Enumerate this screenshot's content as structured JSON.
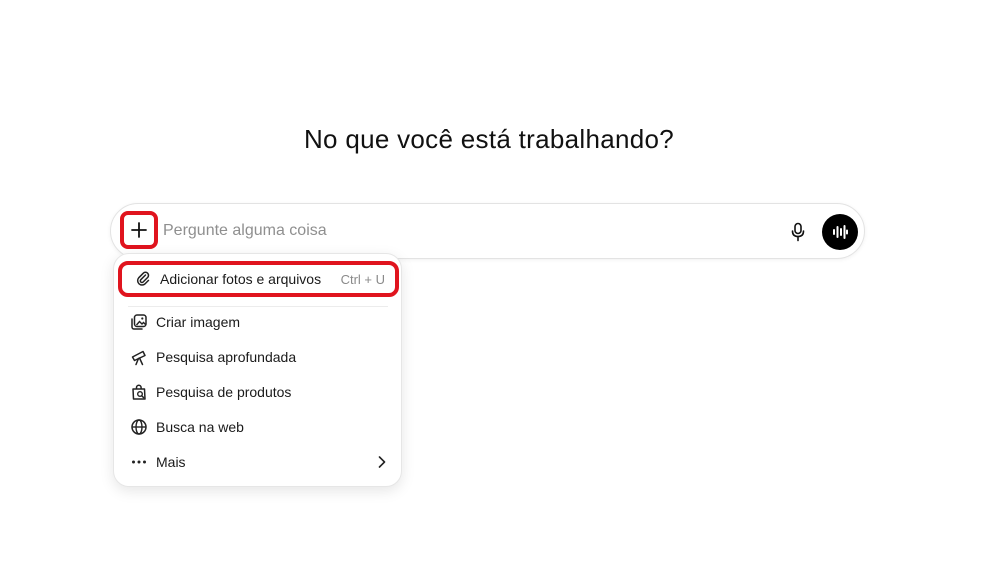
{
  "heading": "No que você está trabalhando?",
  "composer": {
    "placeholder": "Pergunte alguma coisa",
    "plus_icon": "plus-icon",
    "mic_icon": "microphone-icon",
    "voice_icon": "voice-waveform-icon"
  },
  "menu": {
    "upload": {
      "label": "Adicionar fotos e arquivos",
      "shortcut": "Ctrl + U",
      "icon": "paperclip-icon"
    },
    "items": [
      {
        "label": "Criar imagem",
        "icon": "image-create-icon"
      },
      {
        "label": "Pesquisa aprofundada",
        "icon": "telescope-icon"
      },
      {
        "label": "Pesquisa de produtos",
        "icon": "shopping-bag-search-icon"
      },
      {
        "label": "Busca na web",
        "icon": "globe-icon"
      },
      {
        "label": "Mais",
        "icon": "more-dots-icon"
      }
    ]
  },
  "colors": {
    "highlight": "#e0141e",
    "voice_button": "#000000"
  }
}
